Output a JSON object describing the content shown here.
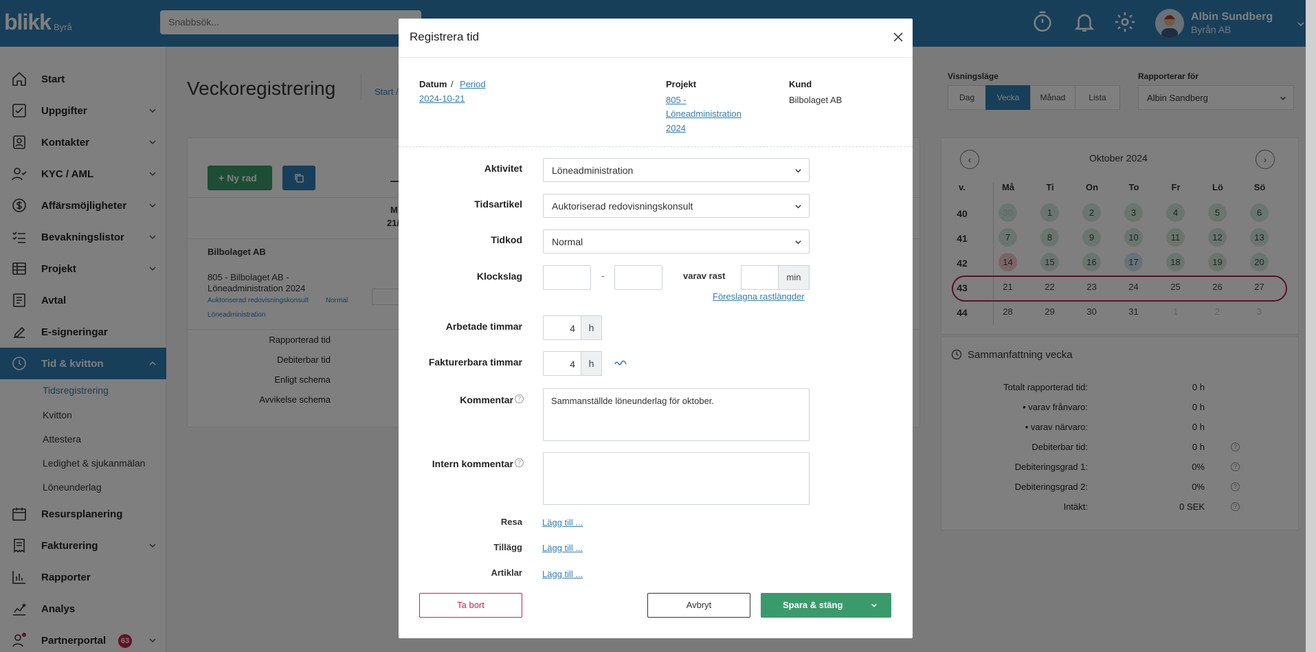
{
  "app": {
    "logo": "blikk",
    "logo_sub": "Byrå",
    "search_placeholder": "Snabbsök..."
  },
  "user": {
    "name": "Albin Sundberg",
    "org": "Byrån AB"
  },
  "sidebar": {
    "items": [
      {
        "label": "Start",
        "icon": "home-icon"
      },
      {
        "label": "Uppgifter",
        "icon": "checkbox-icon"
      },
      {
        "label": "Kontakter",
        "icon": "contacts-icon"
      },
      {
        "label": "KYC / AML",
        "icon": "user-check-icon"
      },
      {
        "label": "Affärsmöjligheter",
        "icon": "dollar-icon"
      },
      {
        "label": "Bevakningslistor",
        "icon": "list-icon"
      },
      {
        "label": "Projekt",
        "icon": "table-icon"
      },
      {
        "label": "Avtal",
        "icon": "document-icon"
      },
      {
        "label": "E-signeringar",
        "icon": "signature-icon"
      },
      {
        "label": "Tid & kvitton",
        "icon": "clock-icon"
      },
      {
        "label": "Resursplanering",
        "icon": "calendar-icon"
      },
      {
        "label": "Fakturering",
        "icon": "invoice-icon"
      },
      {
        "label": "Rapporter",
        "icon": "chart-icon"
      },
      {
        "label": "Analys",
        "icon": "analytics-icon"
      },
      {
        "label": "Partnerportal",
        "icon": "partner-icon"
      }
    ],
    "subitems": [
      "Tidsregistrering",
      "Kvitton",
      "Attestera",
      "Ledighet & sjukanmälan",
      "Löneunderlag"
    ],
    "partner_badge": "63"
  },
  "main": {
    "title": "Veckoregistrering",
    "breadcrumb_start": "Start /",
    "new_row": "Ny rad",
    "col_day": "M",
    "col_date": "21/",
    "client": "Bilbolaget AB",
    "project_line1": "805 - Bilbolaget AB -",
    "project_line2": "Löneadministration 2024",
    "project_tags_1": "Auktoriserad redovisningskonsult",
    "project_tags_2": "Normal",
    "project_tags_3": "Löneadministration",
    "rows": [
      "Rapporterad tid",
      "Debiterbar tid",
      "Enligt schema",
      "Avvikelse schema"
    ]
  },
  "view": {
    "mode_label": "Visningsläge",
    "modes": [
      "Dag",
      "Vecka",
      "Månad",
      "Lista"
    ],
    "reports_for_label": "Rapporterar för",
    "reports_for_value": "Albin Sandberg"
  },
  "calendar": {
    "title": "Oktober 2024",
    "headers": [
      "v.",
      "Må",
      "Ti",
      "On",
      "To",
      "Fr",
      "Lö",
      "Sö"
    ],
    "weeks": [
      {
        "w": "40",
        "days": [
          "30",
          "1",
          "2",
          "3",
          "4",
          "5",
          "6"
        ]
      },
      {
        "w": "41",
        "days": [
          "7",
          "8",
          "9",
          "10",
          "11",
          "12",
          "13"
        ]
      },
      {
        "w": "42",
        "days": [
          "14",
          "15",
          "16",
          "17",
          "18",
          "19",
          "20"
        ]
      },
      {
        "w": "43",
        "days": [
          "21",
          "22",
          "23",
          "24",
          "25",
          "26",
          "27"
        ]
      },
      {
        "w": "44",
        "days": [
          "28",
          "29",
          "30",
          "31",
          "1",
          "2",
          "3"
        ]
      }
    ]
  },
  "summary": {
    "title": "Sammanfattning vecka",
    "rows": [
      {
        "label": "Totalt rapporterad tid:",
        "value": "0 h"
      },
      {
        "label": "varav frånvaro:",
        "value": "0 h"
      },
      {
        "label": "varav närvaro:",
        "value": "0 h"
      },
      {
        "label": "Debiterbar tid:",
        "value": "0 h"
      },
      {
        "label": "Debiteringsgrad 1:",
        "value": "0%"
      },
      {
        "label": "Debiteringsgrad 2:",
        "value": "0%"
      },
      {
        "label": "Intäkt:",
        "value": "0 SEK"
      }
    ]
  },
  "modal": {
    "title": "Registrera tid",
    "datum_label": "Datum",
    "period_link": "Period",
    "date": "2024-10-21",
    "projekt_label": "Projekt",
    "projekt_line1": "805 -",
    "projekt_line2": "Löneadministration",
    "projekt_line3": "2024",
    "kund_label": "Kund",
    "kund_value": "Bilbolaget AB",
    "aktivitet_label": "Aktivitet",
    "aktivitet_value": "Löneadministration",
    "tidsartikel_label": "Tidsartikel",
    "tidsartikel_value": "Auktoriserad redovisningskonsult",
    "tidkod_label": "Tidkod",
    "tidkod_value": "Normal",
    "klockslag_label": "Klockslag",
    "dash": "-",
    "rast_label": "varav rast",
    "rast_unit": "min",
    "rast_link": "Föreslagna rastlängder",
    "arbetade_label": "Arbetade timmar",
    "arbetade_value": "4",
    "fakturerbara_label": "Fakturerbara timmar",
    "fakturerbara_value": "4",
    "hours_unit": "h",
    "kommentar_label": "Kommentar",
    "kommentar_value": "Sammanställde löneunderlag för oktober.",
    "intern_label": "Intern kommentar",
    "resa_label": "Resa",
    "tillagg_label": "Tillägg",
    "artiklar_label": "Artiklar",
    "add_link": "Lägg till ...",
    "delete": "Ta bort",
    "cancel": "Avbryt",
    "save": "Spara & stäng"
  }
}
